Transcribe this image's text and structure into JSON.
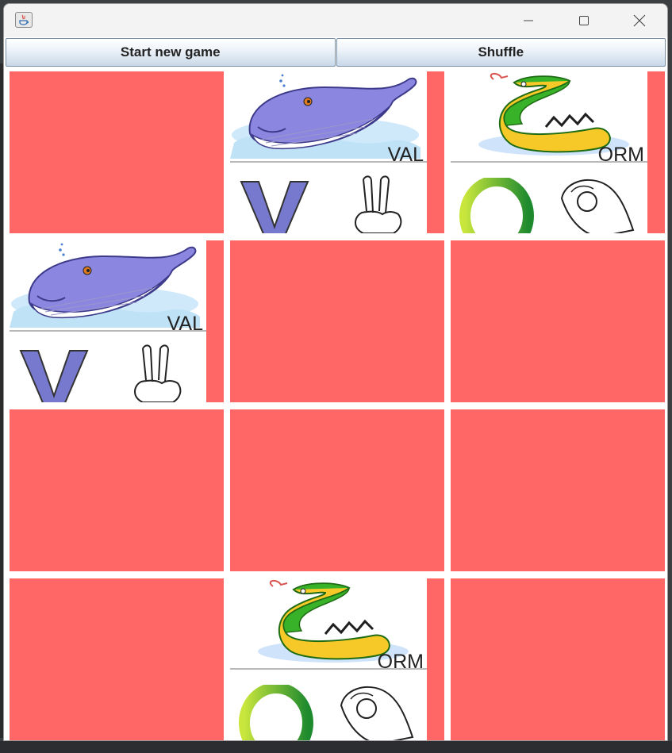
{
  "toolbar": {
    "new_game_label": "Start new game",
    "shuffle_label": "Shuffle"
  },
  "colors": {
    "card_back": "#ff6666",
    "window_bg": "#ffffff"
  },
  "cards": [
    {
      "row": 1,
      "col": 1,
      "state": "face-down"
    },
    {
      "row": 1,
      "col": 2,
      "state": "face-up",
      "word": "VAL",
      "letter": "V",
      "picture": "whale-icon",
      "sign": "v-hand-sign-icon"
    },
    {
      "row": 1,
      "col": 3,
      "state": "face-up",
      "word": "ORM",
      "letter": "O",
      "picture": "snake-icon",
      "sign": "o-hand-sign-icon"
    },
    {
      "row": 2,
      "col": 1,
      "state": "face-up",
      "word": "VAL",
      "letter": "V",
      "picture": "whale-icon",
      "sign": "v-hand-sign-icon"
    },
    {
      "row": 2,
      "col": 2,
      "state": "face-down"
    },
    {
      "row": 2,
      "col": 3,
      "state": "face-down"
    },
    {
      "row": 3,
      "col": 1,
      "state": "face-down"
    },
    {
      "row": 3,
      "col": 2,
      "state": "face-down"
    },
    {
      "row": 3,
      "col": 3,
      "state": "face-down"
    },
    {
      "row": 4,
      "col": 1,
      "state": "face-down"
    },
    {
      "row": 4,
      "col": 2,
      "state": "face-up",
      "word": "ORM",
      "letter": "O",
      "picture": "snake-icon",
      "sign": "o-hand-sign-icon"
    },
    {
      "row": 4,
      "col": 3,
      "state": "face-down"
    }
  ]
}
